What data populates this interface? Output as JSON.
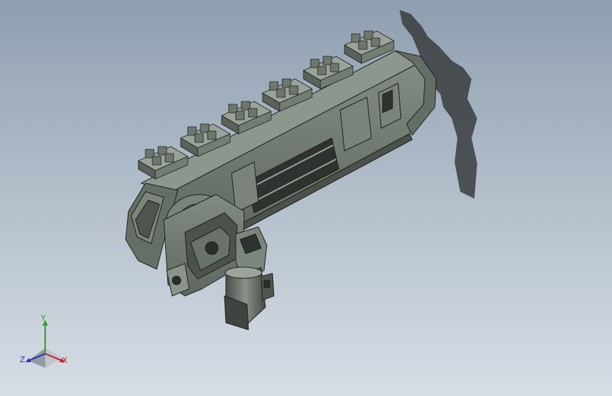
{
  "viewport": {
    "name": "cad-model-viewport",
    "background_top": "#8f9eb0",
    "background_bottom": "#d7dde5"
  },
  "model": {
    "name": "chain-conveyor-assembly",
    "body_color": "#707a70",
    "edge_color": "#1c1f1c",
    "shadow_color": "#3a3d3f"
  },
  "triad": {
    "x_label": "X",
    "y_label": "Y",
    "z_label": "Z",
    "x_color": "#d02020",
    "y_color": "#2aa02a",
    "z_color": "#2030c8"
  }
}
